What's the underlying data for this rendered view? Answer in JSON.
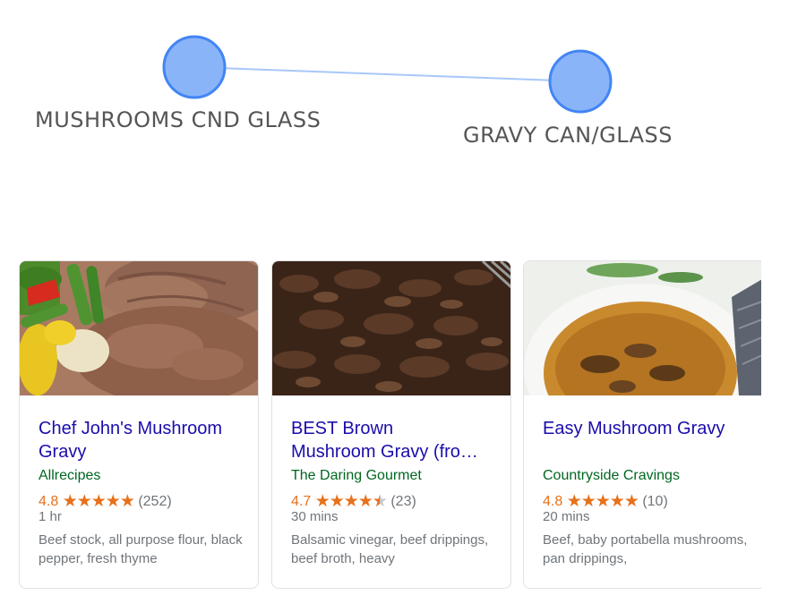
{
  "graph": {
    "nodes": [
      {
        "label": "MUSHROOMS CND GLASS"
      },
      {
        "label": "GRAVY CAN/GLASS"
      }
    ],
    "node_color": "#8ab4f8",
    "node_stroke": "#4285f4",
    "edge_color": "#a8c7fa"
  },
  "recipes": [
    {
      "title_line1": "Chef John's Mushroom",
      "title_line2": "Gravy",
      "source": "Allrecipes",
      "rating": "4.8",
      "stars": 5,
      "review_count": "(252)",
      "time": "1 hr",
      "ingredients": "Beef stock, all purpose flour, black pepper, fresh thyme"
    },
    {
      "title_line1": "BEST Brown",
      "title_line2": "Mushroom Gravy (fro…",
      "source": "The Daring Gourmet",
      "rating": "4.7",
      "stars": 4.5,
      "review_count": "(23)",
      "time": "30 mins",
      "ingredients": "Balsamic vinegar, beef drippings, beef broth, heavy"
    },
    {
      "title_line1": "Easy Mushroom Gravy",
      "title_line2": "",
      "source": "Countryside Cravings",
      "rating": "4.8",
      "stars": 5,
      "review_count": "(10)",
      "time": "20 mins",
      "ingredients": "Beef, baby portabella mushrooms, pan drippings,"
    }
  ],
  "colors": {
    "title_link": "#1a0dab",
    "source": "#006621",
    "rating": "#e7711b",
    "meta": "#70757a"
  }
}
